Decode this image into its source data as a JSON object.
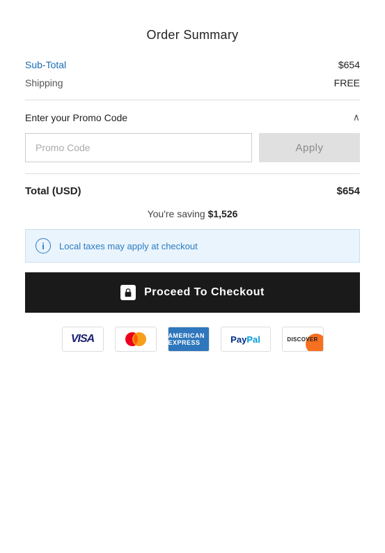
{
  "page": {
    "title": "Order Summary",
    "subtotal": {
      "label": "Sub-Total",
      "value": "$654"
    },
    "shipping": {
      "label": "Shipping",
      "value": "FREE"
    },
    "promo": {
      "label": "Enter your Promo Code",
      "placeholder": "Promo Code",
      "apply_label": "Apply"
    },
    "total": {
      "label": "Total (USD)",
      "value": "$654"
    },
    "saving": {
      "prefix": "You're saving ",
      "amount": "$1,526"
    },
    "info": {
      "text": "Local taxes may apply at checkout"
    },
    "checkout": {
      "label": "Proceed To Checkout"
    },
    "payment_icons": [
      "visa",
      "mastercard",
      "amex",
      "paypal",
      "discover"
    ]
  }
}
